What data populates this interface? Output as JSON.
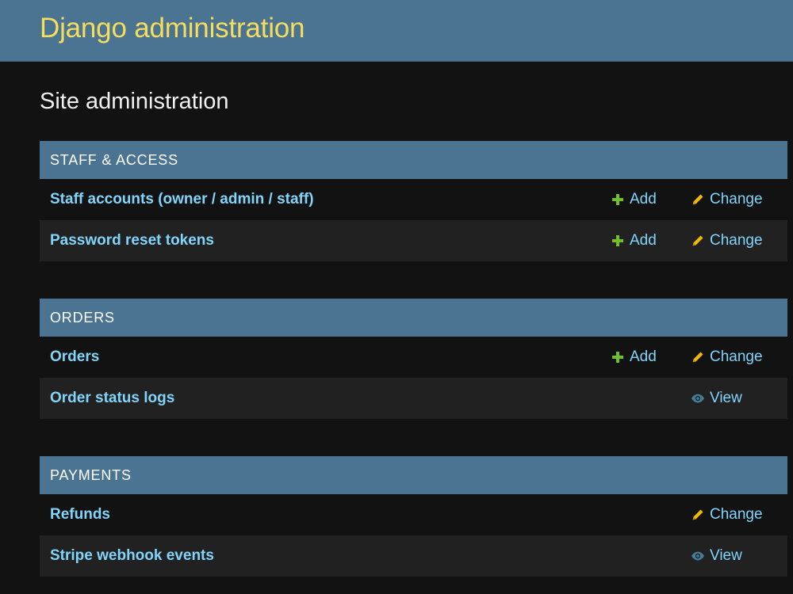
{
  "header": {
    "branding": "Django administration"
  },
  "page": {
    "title": "Site administration"
  },
  "colors": {
    "header_bg": "#4a7491",
    "branding": "#f5dd5d",
    "link": "#81d4fa",
    "add_icon": "#70bf2b",
    "change_icon": "#efb80b",
    "view_icon": "#447e9b"
  },
  "modules": [
    {
      "caption": "STAFF & ACCESS",
      "rows": [
        {
          "model": "Staff accounts (owner / admin / staff)",
          "add": "Add",
          "change": "Change"
        },
        {
          "model": "Password reset tokens",
          "add": "Add",
          "change": "Change"
        }
      ]
    },
    {
      "caption": "ORDERS",
      "rows": [
        {
          "model": "Orders",
          "add": "Add",
          "change": "Change"
        },
        {
          "model": "Order status logs",
          "view": "View"
        }
      ]
    },
    {
      "caption": "PAYMENTS",
      "rows": [
        {
          "model": "Refunds",
          "change": "Change"
        },
        {
          "model": "Stripe webhook events",
          "view": "View"
        }
      ]
    }
  ],
  "icons": {
    "add": "plus-icon",
    "change": "pencil-icon",
    "view": "eye-icon"
  }
}
